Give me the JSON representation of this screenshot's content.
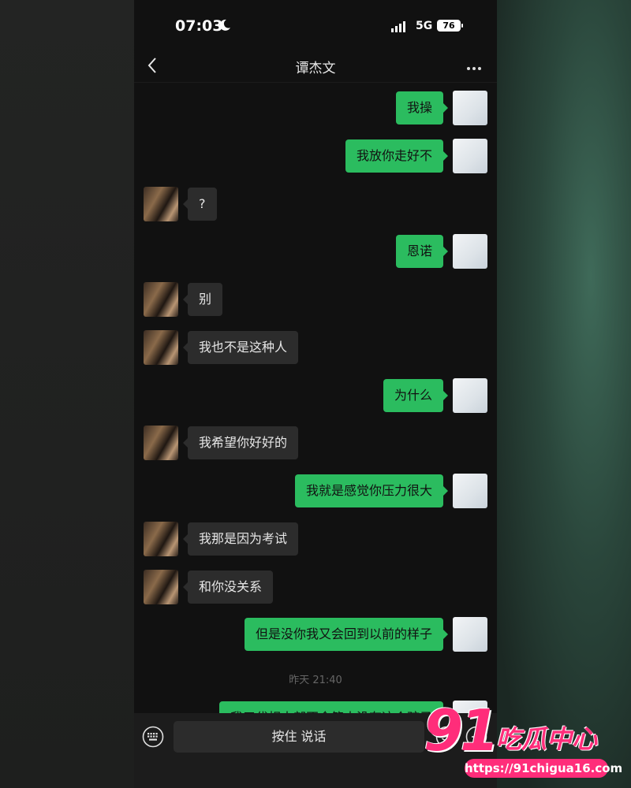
{
  "status": {
    "time": "07:03",
    "network": "5G",
    "battery": "76"
  },
  "header": {
    "title": "谭杰文"
  },
  "messages": [
    {
      "side": "self",
      "text": "我操"
    },
    {
      "side": "self",
      "text": "我放你走好不"
    },
    {
      "side": "other",
      "text": "?"
    },
    {
      "side": "self",
      "text": "恩诺"
    },
    {
      "side": "other",
      "text": "别"
    },
    {
      "side": "other",
      "text": "我也不是这种人"
    },
    {
      "side": "self",
      "text": "为什么"
    },
    {
      "side": "other",
      "text": "我希望你好好的"
    },
    {
      "side": "self",
      "text": "我就是感觉你压力很大"
    },
    {
      "side": "other",
      "text": "我那是因为考试"
    },
    {
      "side": "other",
      "text": "和你没关系"
    },
    {
      "side": "self",
      "text": "但是没你我又会回到以前的样子"
    },
    {
      "side": "self",
      "text": "我三代相大部不令简大没有这个孩子"
    }
  ],
  "timestamp": "昨天 21:40",
  "input": {
    "voice_label": "按住 说话"
  },
  "watermark": {
    "number": "91",
    "name": "吃瓜中心",
    "url": "https://91chigua16.com"
  },
  "colors": {
    "self_bubble": "#2bbc5f",
    "other_bubble": "#2c2c2c",
    "watermark": "#ff2d7a"
  }
}
